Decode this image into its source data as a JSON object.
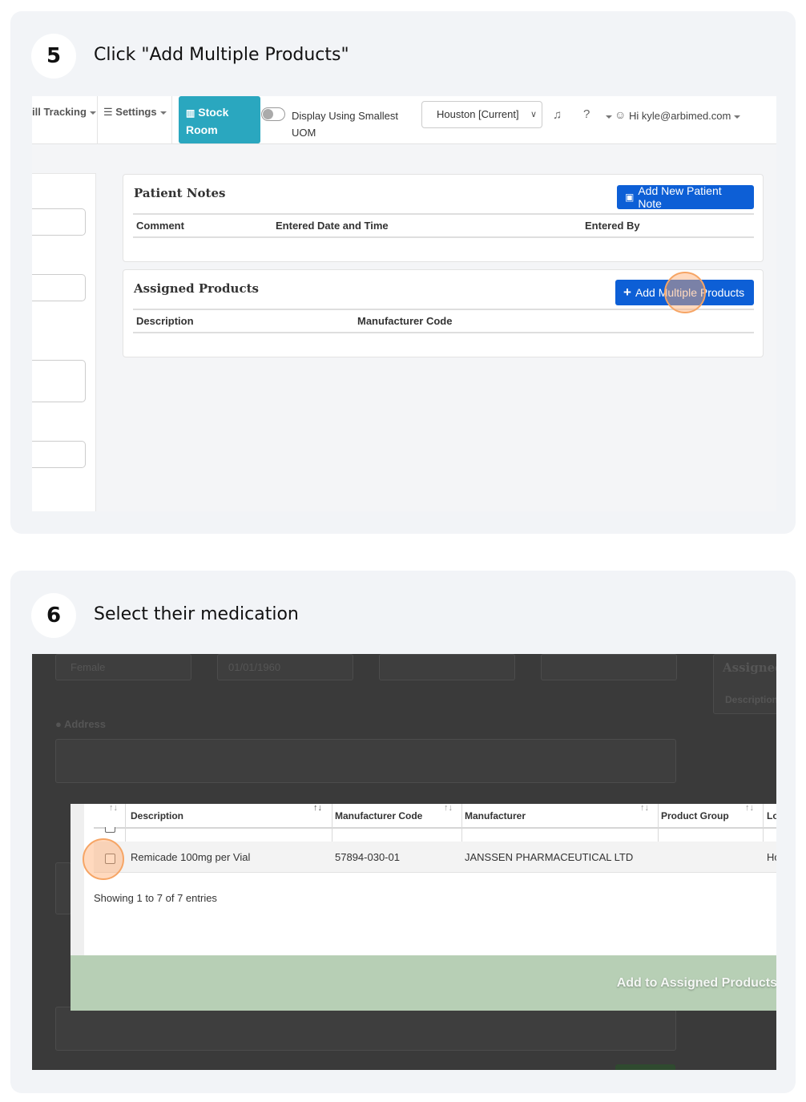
{
  "step5": {
    "number": "5",
    "title": "Click \"Add Multiple Products\"",
    "nav": {
      "bill_tracking": "ill Tracking",
      "settings": "Settings",
      "stock_room_line1": "Stock",
      "stock_room_line2": "Room",
      "display_toggle_label": "Display Using Smallest UOM",
      "location_select": "Houston [Current]",
      "user": "Hi kyle@arbimed.com"
    },
    "patient_notes": {
      "title": "Patient Notes",
      "add_button": "Add New Patient Note",
      "columns": [
        "Comment",
        "Entered Date and Time",
        "Entered By"
      ]
    },
    "assigned_products": {
      "title": "Assigned Products",
      "add_button": "Add Multiple Products",
      "columns": [
        "Description",
        "Manufacturer Code"
      ]
    }
  },
  "step6": {
    "number": "6",
    "title": "Select their medication",
    "background": {
      "gender_value": "Female",
      "dob_value": "01/01/1960",
      "address_label": "Address",
      "assigned_label": "Assigned",
      "description_label": "Description"
    },
    "table": {
      "columns": [
        "Description",
        "Manufacturer Code",
        "Manufacturer",
        "Product Group",
        "Lo"
      ],
      "rows": [
        {
          "description": "Remicade 100mg per Vial",
          "manufacturer_code": "57894-030-01",
          "manufacturer": "JANSSEN PHARMACEUTICAL LTD",
          "product_group": "",
          "location": "Ho",
          "checked": false
        }
      ],
      "showing": "Showing 1 to 7 of 7 entries"
    },
    "footer_button": "Add to Assigned Products"
  },
  "colors": {
    "primary_blue": "#0d5fd6",
    "stock_teal": "#2aa7bf",
    "footer_green": "#b7cfb5",
    "highlight_orange": "#f6a565"
  }
}
